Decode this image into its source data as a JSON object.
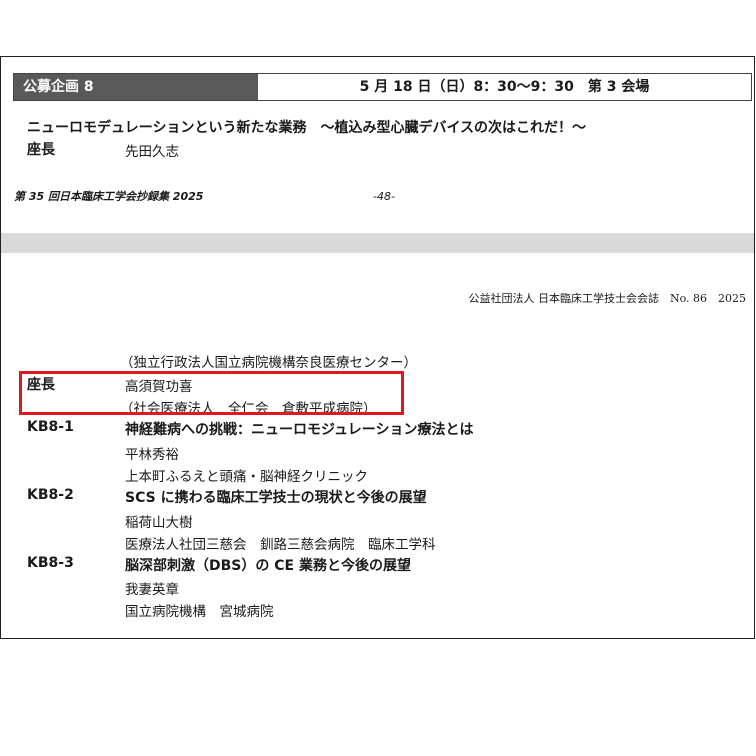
{
  "session": {
    "label": "公募企画 8",
    "date_time_room": "5 月 18 日（日）8：30〜9：30　第 3 会場",
    "title": "ニューロモデュレーションという新たな業務　〜植込み型心臓デバイスの次はこれだ！〜",
    "chair1_label": "座長",
    "chair1_name": "先田久志",
    "chair1_affiliation": "（独立行政法人国立病院機構奈良医療センター）",
    "chair2_label": "座長",
    "chair2_name": "高須賀功喜",
    "chair2_affiliation": "（社会医療法人　全仁会　倉敷平成病院）"
  },
  "footer": {
    "proceedings": "第 35 回日本臨床工学会抄録集 2025",
    "page": "-48-"
  },
  "journal": "公益社団法人 日本臨床工学技士会会誌　No. 86　2025",
  "lectures": [
    {
      "code": "KB8-1",
      "title": "神経難病への挑戦：ニューロモジュレーション療法とは",
      "speaker": "平林秀裕",
      "affiliation": "上本町ふるえと頭痛・脳神経クリニック"
    },
    {
      "code": "KB8-2",
      "title": "SCS に携わる臨床工学技士の現状と今後の展望",
      "speaker": "稲荷山大樹",
      "affiliation": "医療法人社団三慈会　釧路三慈会病院　臨床工学科"
    },
    {
      "code": "KB8-3",
      "title": "脳深部刺激（DBS）の CE 業務と今後の展望",
      "speaker": "我妻英章",
      "affiliation": "国立病院機構　宮城病院"
    }
  ],
  "colors": {
    "header_bg": "#595959",
    "highlight": "#e0191f",
    "gap": "#d9d9d9"
  }
}
